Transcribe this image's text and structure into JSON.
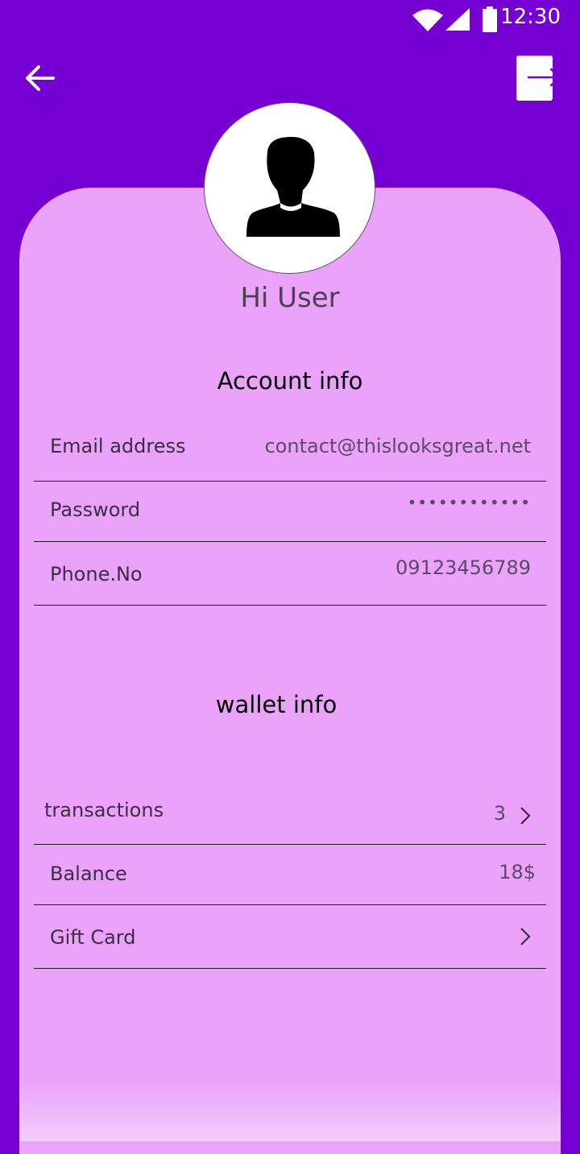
{
  "status_bar": {
    "time": "12:30"
  },
  "header": {
    "back_icon": "arrow-left-icon",
    "logout_icon": "logout-icon"
  },
  "profile": {
    "greeting": "Hi User"
  },
  "account_info": {
    "title": "Account info",
    "rows": [
      {
        "label": "Email address",
        "value": "contact@thislooksgreat.net"
      },
      {
        "label": "Password",
        "value": "••••••••••••"
      },
      {
        "label": "Phone.No",
        "value": "09123456789"
      }
    ]
  },
  "wallet_info": {
    "title": "wallet info",
    "rows": [
      {
        "label": "transactions",
        "value": "3"
      },
      {
        "label": "Balance",
        "value": "18$"
      },
      {
        "label": "Gift Card",
        "value": ""
      }
    ]
  },
  "colors": {
    "background": "#7600D3",
    "card": "#EAA2FB",
    "accent": "#7600D3"
  }
}
